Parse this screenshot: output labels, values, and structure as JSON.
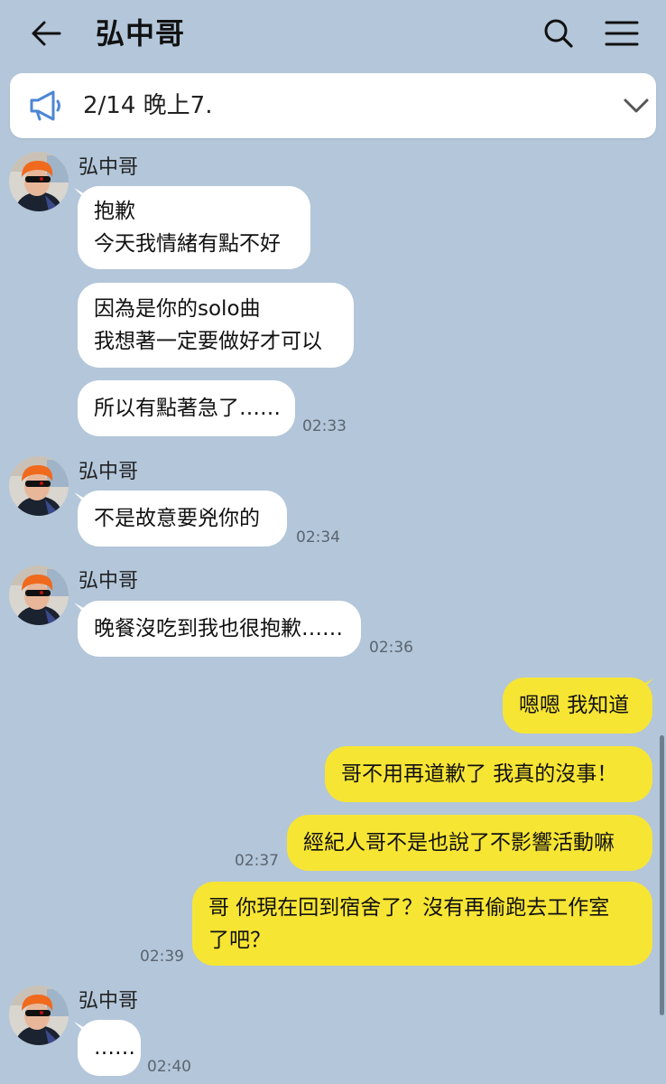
{
  "header": {
    "back_icon": "arrow-left-icon",
    "title": "弘中哥",
    "search_icon": "search-icon",
    "menu_icon": "hamburger-menu-icon"
  },
  "announcement": {
    "icon": "megaphone-icon",
    "text": "2/14 晚上7.",
    "expand_icon": "chevron-down-icon"
  },
  "colors": {
    "background": "#b3c6da",
    "incoming_bubble": "#ffffff",
    "outgoing_bubble": "#f7e534"
  },
  "messages": {
    "g1": {
      "sender": "弘中哥",
      "b1": [
        "抱歉",
        "今天我情緒有點不好"
      ],
      "b2": [
        "因為是你的solo曲",
        "我想著一定要做好才可以"
      ],
      "b3": [
        "所以有點著急了……"
      ],
      "time": "02:33"
    },
    "g2": {
      "sender": "弘中哥",
      "b1": [
        "不是故意要兇你的"
      ],
      "time": "02:34"
    },
    "g3": {
      "sender": "弘中哥",
      "b1": [
        "晚餐沒吃到我也很抱歉……"
      ],
      "time": "02:36"
    },
    "me1": {
      "b1": [
        "嗯嗯 我知道"
      ]
    },
    "me2": {
      "b1": [
        "哥不用再道歉了 我真的沒事！"
      ]
    },
    "me3": {
      "b1": [
        "經紀人哥不是也說了不影響活動嘛"
      ],
      "time": "02:37"
    },
    "me4": {
      "b1": [
        "哥 你現在回到宿舍了？沒有再偷跑去工作室",
        "了吧？"
      ],
      "time": "02:39"
    },
    "g4": {
      "sender": "弘中哥",
      "b1": [
        "……"
      ],
      "time": "02:40"
    }
  }
}
